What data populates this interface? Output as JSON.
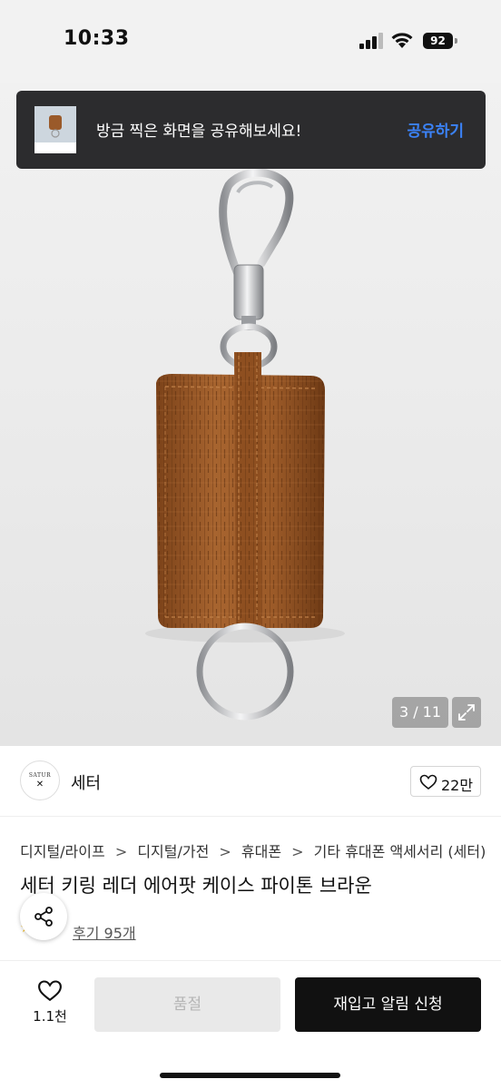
{
  "status_bar": {
    "time": "10:33",
    "battery": "92",
    "icons": [
      "signal-icon",
      "wifi-icon",
      "battery-icon"
    ]
  },
  "share_toast": {
    "message": "방금 찍은 화면을 공유해보세요!",
    "action": "공유하기",
    "action_color": "#3b82f6"
  },
  "gallery": {
    "indicator": "3 / 11",
    "expand_icon": "expand-icon",
    "current_page": 3,
    "total_pages": 11
  },
  "brand": {
    "logo_text": "SATUR",
    "logo_mark": "✕",
    "name": "세터",
    "like_count": "22만"
  },
  "breadcrumb": {
    "items": [
      "디지털/라이프",
      "디지털/가전",
      "휴대폰",
      "기타 휴대폰 액세서리 (세터)"
    ],
    "separator": ">"
  },
  "product": {
    "title": "세터 키링 레더 에어팟 케이스 파이톤 브라운"
  },
  "review": {
    "star": "★",
    "link_label": "후기 95개"
  },
  "bottom_bar": {
    "wish_count": "1.1천",
    "soldout_label": "품절",
    "restock_label": "재입고 알림 신청"
  },
  "colors": {
    "leather": "#9a5a2a",
    "toast_bg": "#2c2c2e",
    "primary_button": "#111111",
    "disabled_button": "#e9e9e9"
  }
}
